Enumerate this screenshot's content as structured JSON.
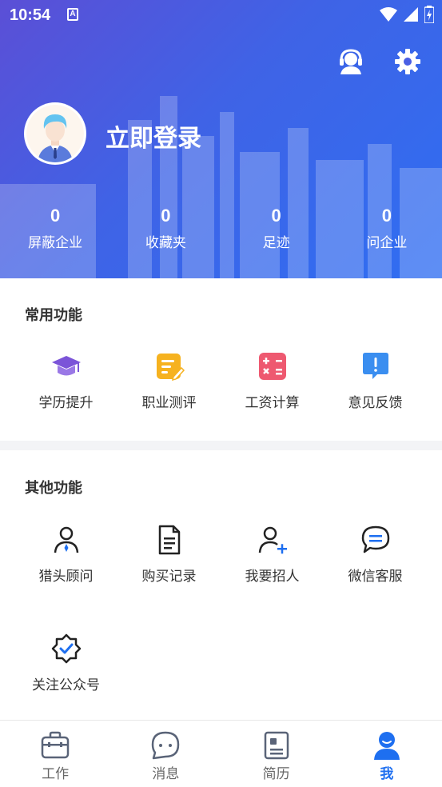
{
  "status_bar": {
    "time": "10:54",
    "notification_glyph": "A"
  },
  "header": {
    "login_label": "立即登录",
    "stats": [
      {
        "value": "0",
        "label": "屏蔽企业"
      },
      {
        "value": "0",
        "label": "收藏夹"
      },
      {
        "value": "0",
        "label": "足迹"
      },
      {
        "value": "0",
        "label": "问企业"
      }
    ]
  },
  "common": {
    "title": "常用功能",
    "items": [
      {
        "label": "学历提升",
        "icon": "graduation-cap-icon"
      },
      {
        "label": "职业测评",
        "icon": "edit-note-icon"
      },
      {
        "label": "工资计算",
        "icon": "calculator-icon"
      },
      {
        "label": "意见反馈",
        "icon": "feedback-icon"
      }
    ]
  },
  "other": {
    "title": "其他功能",
    "items": [
      {
        "label": "猎头顾问",
        "icon": "consultant-icon"
      },
      {
        "label": "购买记录",
        "icon": "document-icon"
      },
      {
        "label": "我要招人",
        "icon": "add-user-icon"
      },
      {
        "label": "微信客服",
        "icon": "chat-icon"
      },
      {
        "label": "关注公众号",
        "icon": "verified-badge-icon"
      }
    ]
  },
  "nav": {
    "items": [
      {
        "label": "工作",
        "icon": "briefcase-icon"
      },
      {
        "label": "消息",
        "icon": "message-icon"
      },
      {
        "label": "简历",
        "icon": "resume-icon"
      },
      {
        "label": "我",
        "icon": "profile-icon",
        "active": true
      }
    ]
  },
  "colors": {
    "accent": "#1e6ff0",
    "header_start": "#5b4fd6",
    "header_end": "#2f6ef2"
  }
}
